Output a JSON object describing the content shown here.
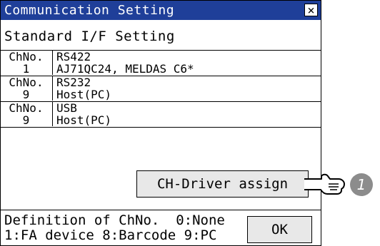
{
  "window": {
    "title": "Communication Setting",
    "close_label": "×"
  },
  "subtitle": "Standard I/F Setting",
  "channels": [
    {
      "header_label": "ChNo.",
      "interface": "RS422",
      "number": "1",
      "driver": "AJ71QC24, MELDAS C6*"
    },
    {
      "header_label": "ChNo.",
      "interface": "RS232",
      "number": "9",
      "driver": "Host(PC)"
    },
    {
      "header_label": "ChNo.",
      "interface": "USB",
      "number": "9",
      "driver": "Host(PC)"
    }
  ],
  "buttons": {
    "assign_label": "CH-Driver assign",
    "ok_label": "OK"
  },
  "definition": {
    "line1": "Definition of ChNo.  0:None",
    "line2": "1:FA device 8:Barcode 9:PC"
  },
  "callout": {
    "number": "1"
  },
  "colors": {
    "titlebar": "#1f3f99",
    "button_face": "#e8e8e8",
    "callout_circle": "#8c8c8c"
  }
}
